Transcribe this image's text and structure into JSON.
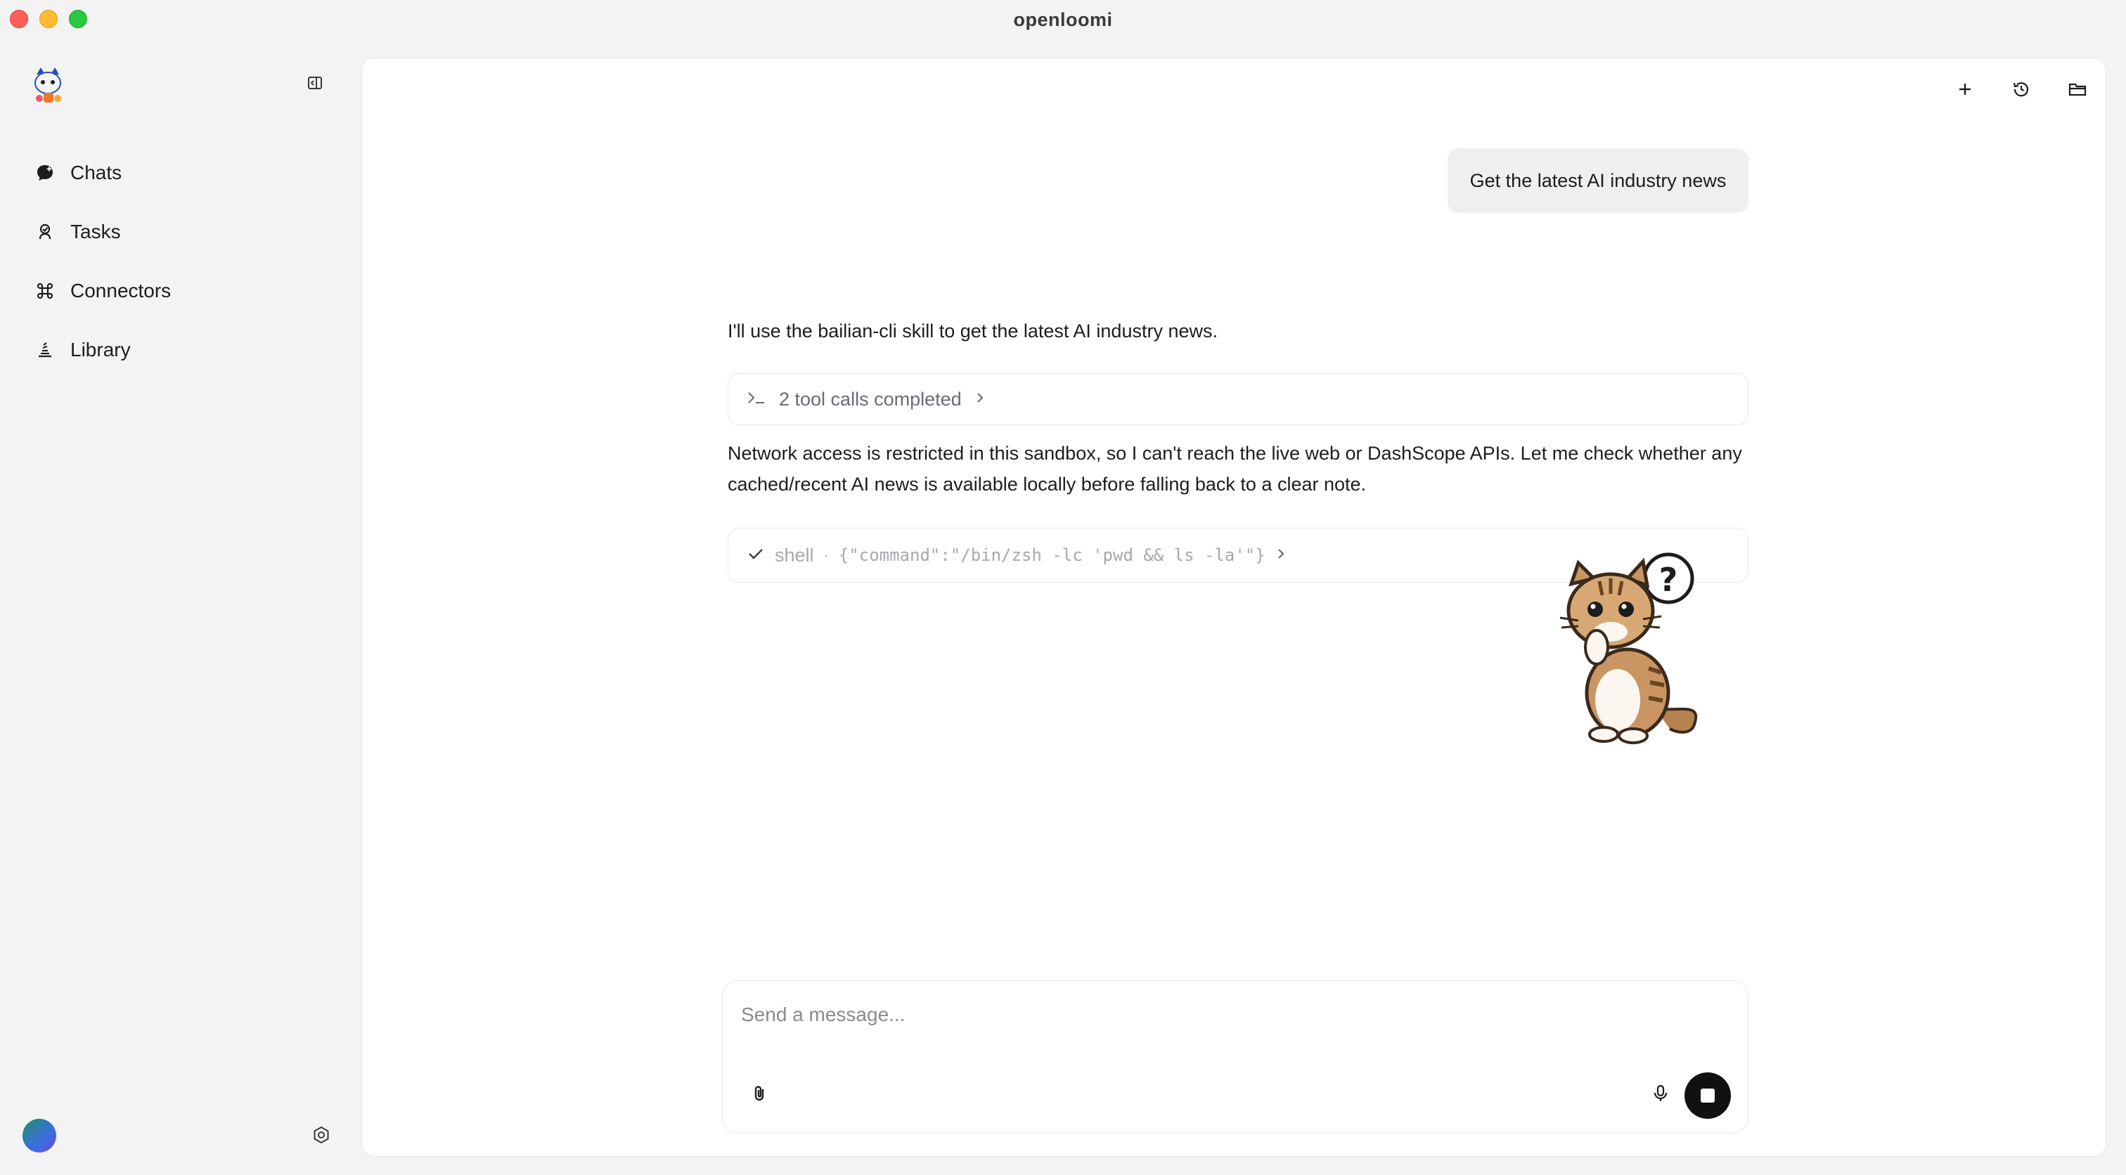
{
  "window": {
    "title": "openloomi"
  },
  "sidebar": {
    "items": [
      {
        "label": "Chats",
        "icon": "chat-bubble-icon"
      },
      {
        "label": "Tasks",
        "icon": "tasks-icon"
      },
      {
        "label": "Connectors",
        "icon": "command-icon"
      },
      {
        "label": "Library",
        "icon": "library-icon"
      }
    ]
  },
  "header": {
    "actions": [
      "plus-icon",
      "history-icon",
      "folder-icon"
    ]
  },
  "conversation": {
    "user_message": "Get the latest AI industry news",
    "assistant_intro": "I'll use the bailian-cli skill to get the latest AI industry news.",
    "tool_summary": "2 tool calls completed",
    "assistant_followup": "Network access is restricted in this sandbox, so I can't reach the live web or DashScope APIs. Let me check whether any cached/recent AI news is available locally before falling back to a clear note.",
    "tool_call": {
      "name": "shell",
      "separator": "·",
      "args": "{\"command\":\"/bin/zsh -lc 'pwd && ls -la'\"}"
    }
  },
  "composer": {
    "placeholder": "Send a message...",
    "value": ""
  },
  "colors": {
    "accent": "#111111",
    "panel": "#ffffff",
    "background": "#f3f3f4"
  }
}
